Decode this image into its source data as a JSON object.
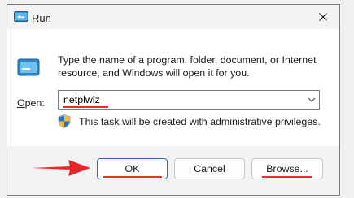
{
  "window": {
    "title": "Run",
    "close_icon": "close-icon"
  },
  "content": {
    "description": "Type the name of a program, folder, document, or Internet resource, and Windows will open it for you.",
    "open_label_hotkey": "O",
    "open_label_rest": "pen:",
    "open_value": "netplwiz",
    "admin_notice": "This task will be created with administrative privileges."
  },
  "buttons": {
    "ok": "OK",
    "cancel": "Cancel",
    "browse": "Browse..."
  },
  "colors": {
    "annotation_red": "#e03030",
    "focus_blue": "#2c6bbf"
  }
}
